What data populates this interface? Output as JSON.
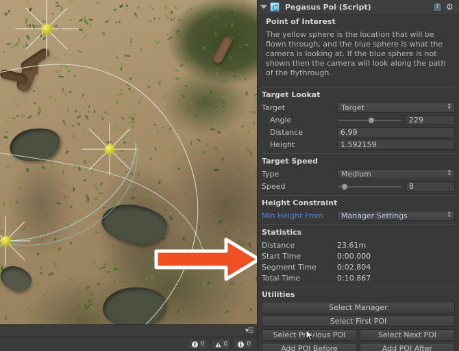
{
  "inspector": {
    "component": {
      "title": "Pegasus Poi (Script)",
      "foldout_icon": "triangle-down-icon",
      "script_icon": "script-icon",
      "help_icon": "help-icon",
      "help_glyph": "?",
      "gear_icon": "gear-icon",
      "gear_glyph": "⚙"
    },
    "description": {
      "title": "Point of Interest",
      "text": "The yellow sphere is the location that will be flown through, and the blue sphere is what the camera is looking at. If the blue sphere is not shown then the camera will look along the path of the flythrough."
    },
    "target_lookat": {
      "title": "Target Lookat",
      "target_label": "Target",
      "target_value": "Target",
      "angle_label": "Angle",
      "angle_value": "229",
      "angle_percent": 52,
      "distance_label": "Distance",
      "distance_value": "6.99",
      "height_label": "Height",
      "height_value": "1.592159"
    },
    "target_speed": {
      "title": "Target Speed",
      "type_label": "Type",
      "type_value": "Medium",
      "speed_label": "Speed",
      "speed_value": "8",
      "speed_percent": 11
    },
    "height_constraint": {
      "title": "Height Constraint",
      "min_height_label": "Min Height From",
      "min_height_value": "Manager Settings"
    },
    "statistics": {
      "title": "Statistics",
      "rows": [
        {
          "label": "Distance",
          "value": "23.61m"
        },
        {
          "label": "Start Time",
          "value": "0:00.000"
        },
        {
          "label": "Segment Time",
          "value": "0:02.804"
        },
        {
          "label": "Total Time",
          "value": "0:10.867"
        }
      ]
    },
    "utilities": {
      "title": "Utilities",
      "select_manager": "Select Manager",
      "select_first_poi": "Select First POI",
      "select_previous_poi": "Select Previous POI",
      "select_next_poi": "Select Next POI",
      "add_poi_before": "Add POI Before",
      "add_poi_after": "Add POI After"
    }
  },
  "scene": {
    "name": "scene-view",
    "status_bar": {
      "error_count": "0",
      "warning_count": "0",
      "info_count": "0"
    }
  },
  "annotation": {
    "arrow_name": "orange-arrow-annotation",
    "arrow_color": "#F04E23",
    "arrow_outline": "#FFFFFF"
  },
  "colors": {
    "panel_bg": "#393939",
    "field_bg": "#434343",
    "text": "#C3C3C3",
    "link_blue": "#4D86D4",
    "poi_yellow": "#D9D234"
  }
}
